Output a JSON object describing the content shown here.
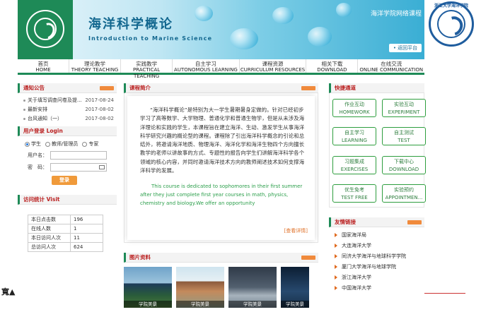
{
  "banner": {
    "title_cn": "海洋科学概论",
    "title_en": "Introduction to Marine Science",
    "subtitle": "海洋学院网络课程",
    "return_label": "• 返回平台"
  },
  "nav": [
    {
      "cn": "首页",
      "en": "HOME"
    },
    {
      "cn": "理论教学",
      "en": "THEORY TEACHING"
    },
    {
      "cn": "实践教学",
      "en": "PRACTICAL TEACHING"
    },
    {
      "cn": "自主学习",
      "en": "AUTONOMOUS LEARNING"
    },
    {
      "cn": "课程资源",
      "en": "CURRICULUM RESOURCES"
    },
    {
      "cn": "相关下载",
      "en": "DOWNLOAD"
    },
    {
      "cn": "在线交流",
      "en": "ONLINE COMMUNICATION"
    }
  ],
  "notice": {
    "title": "通知公告",
    "items": [
      {
        "text": "关于填写调查问卷及提...",
        "date": "2017-08-24"
      },
      {
        "text": "最新安排",
        "date": "2017-08-02"
      },
      {
        "text": "台风通知（一）",
        "date": "2017-08-02"
      }
    ]
  },
  "login": {
    "title": "用户登录 Login",
    "roles": [
      "学生",
      "教师/管理员",
      "专家"
    ],
    "user_label": "用户名：",
    "pass_label": "密　码：",
    "button": "登录"
  },
  "stats": {
    "title": "访问统计 Visit",
    "rows": [
      {
        "k": "本日点击数",
        "v": "196"
      },
      {
        "k": "在线人数",
        "v": "1"
      },
      {
        "k": "本日访问人次",
        "v": "11"
      },
      {
        "k": "总访问人次",
        "v": "624"
      }
    ]
  },
  "intro": {
    "title": "课程简介",
    "cn": "“海洋科学概论”是特别为大一学生暑期暑身定做的。针对已经初步学习了高等数学、大学物理、普通化学和普通生物学，但是从未涉及海洋理论和实践的学生，本课程旨在建立海洋、生动、激发学生从事海洋科学研究兴趣的概论型的课程。课程除了引出海洋科学概念的引论和总结外，将邀请海洋地质、物理海洋、海洋化学和海洋生物四个方向擅长教学的老师以讲故事的方式、专题性的报告向学生们讲解海洋科学各个领域的核心内容，并同时邀请海洋技术方向的教师阐述技术如何支撑海洋科学的发展。",
    "en": "This course is dedicated to sophomores in their first summer after they just complete first year courses in math, physics, chemistry and biology.We offer an opportunity",
    "more": "[查看详情]"
  },
  "photos": {
    "title": "图片资料",
    "items": [
      {
        "caption": "学院美景"
      },
      {
        "caption": "学院美景"
      },
      {
        "caption": "学院美景"
      },
      {
        "caption": "学院美景"
      }
    ]
  },
  "quick": {
    "title": "快捷通道",
    "items": [
      {
        "cn": "作业互动",
        "en": "HOMEWORK"
      },
      {
        "cn": "实验互动",
        "en": "EXPERIMENT"
      },
      {
        "cn": "自主学习",
        "en": "LEARNING"
      },
      {
        "cn": "自主测试",
        "en": "TEST"
      },
      {
        "cn": "习题集成",
        "en": "EXERCISES"
      },
      {
        "cn": "下载中心",
        "en": "DOWNLOAD"
      },
      {
        "cn": "优生免考",
        "en": "TEST FREE"
      },
      {
        "cn": "实验预约",
        "en": "APPOINTMEN..."
      }
    ]
  },
  "links": {
    "title": "友情链接",
    "items": [
      "国家海洋局",
      "大连海洋大学",
      "同济大学海洋与地球科学学院",
      "厦门大学海洋与地球学院",
      "浙江海洋大学",
      "中国海洋大学"
    ]
  },
  "side_logo_text": "浙江大学海洋学院",
  "corner_text": "寬▲",
  "colors": {
    "brand_green": "#1e8a57",
    "accent_orange": "#f09a3a",
    "ocean_blue": "#12678f"
  }
}
